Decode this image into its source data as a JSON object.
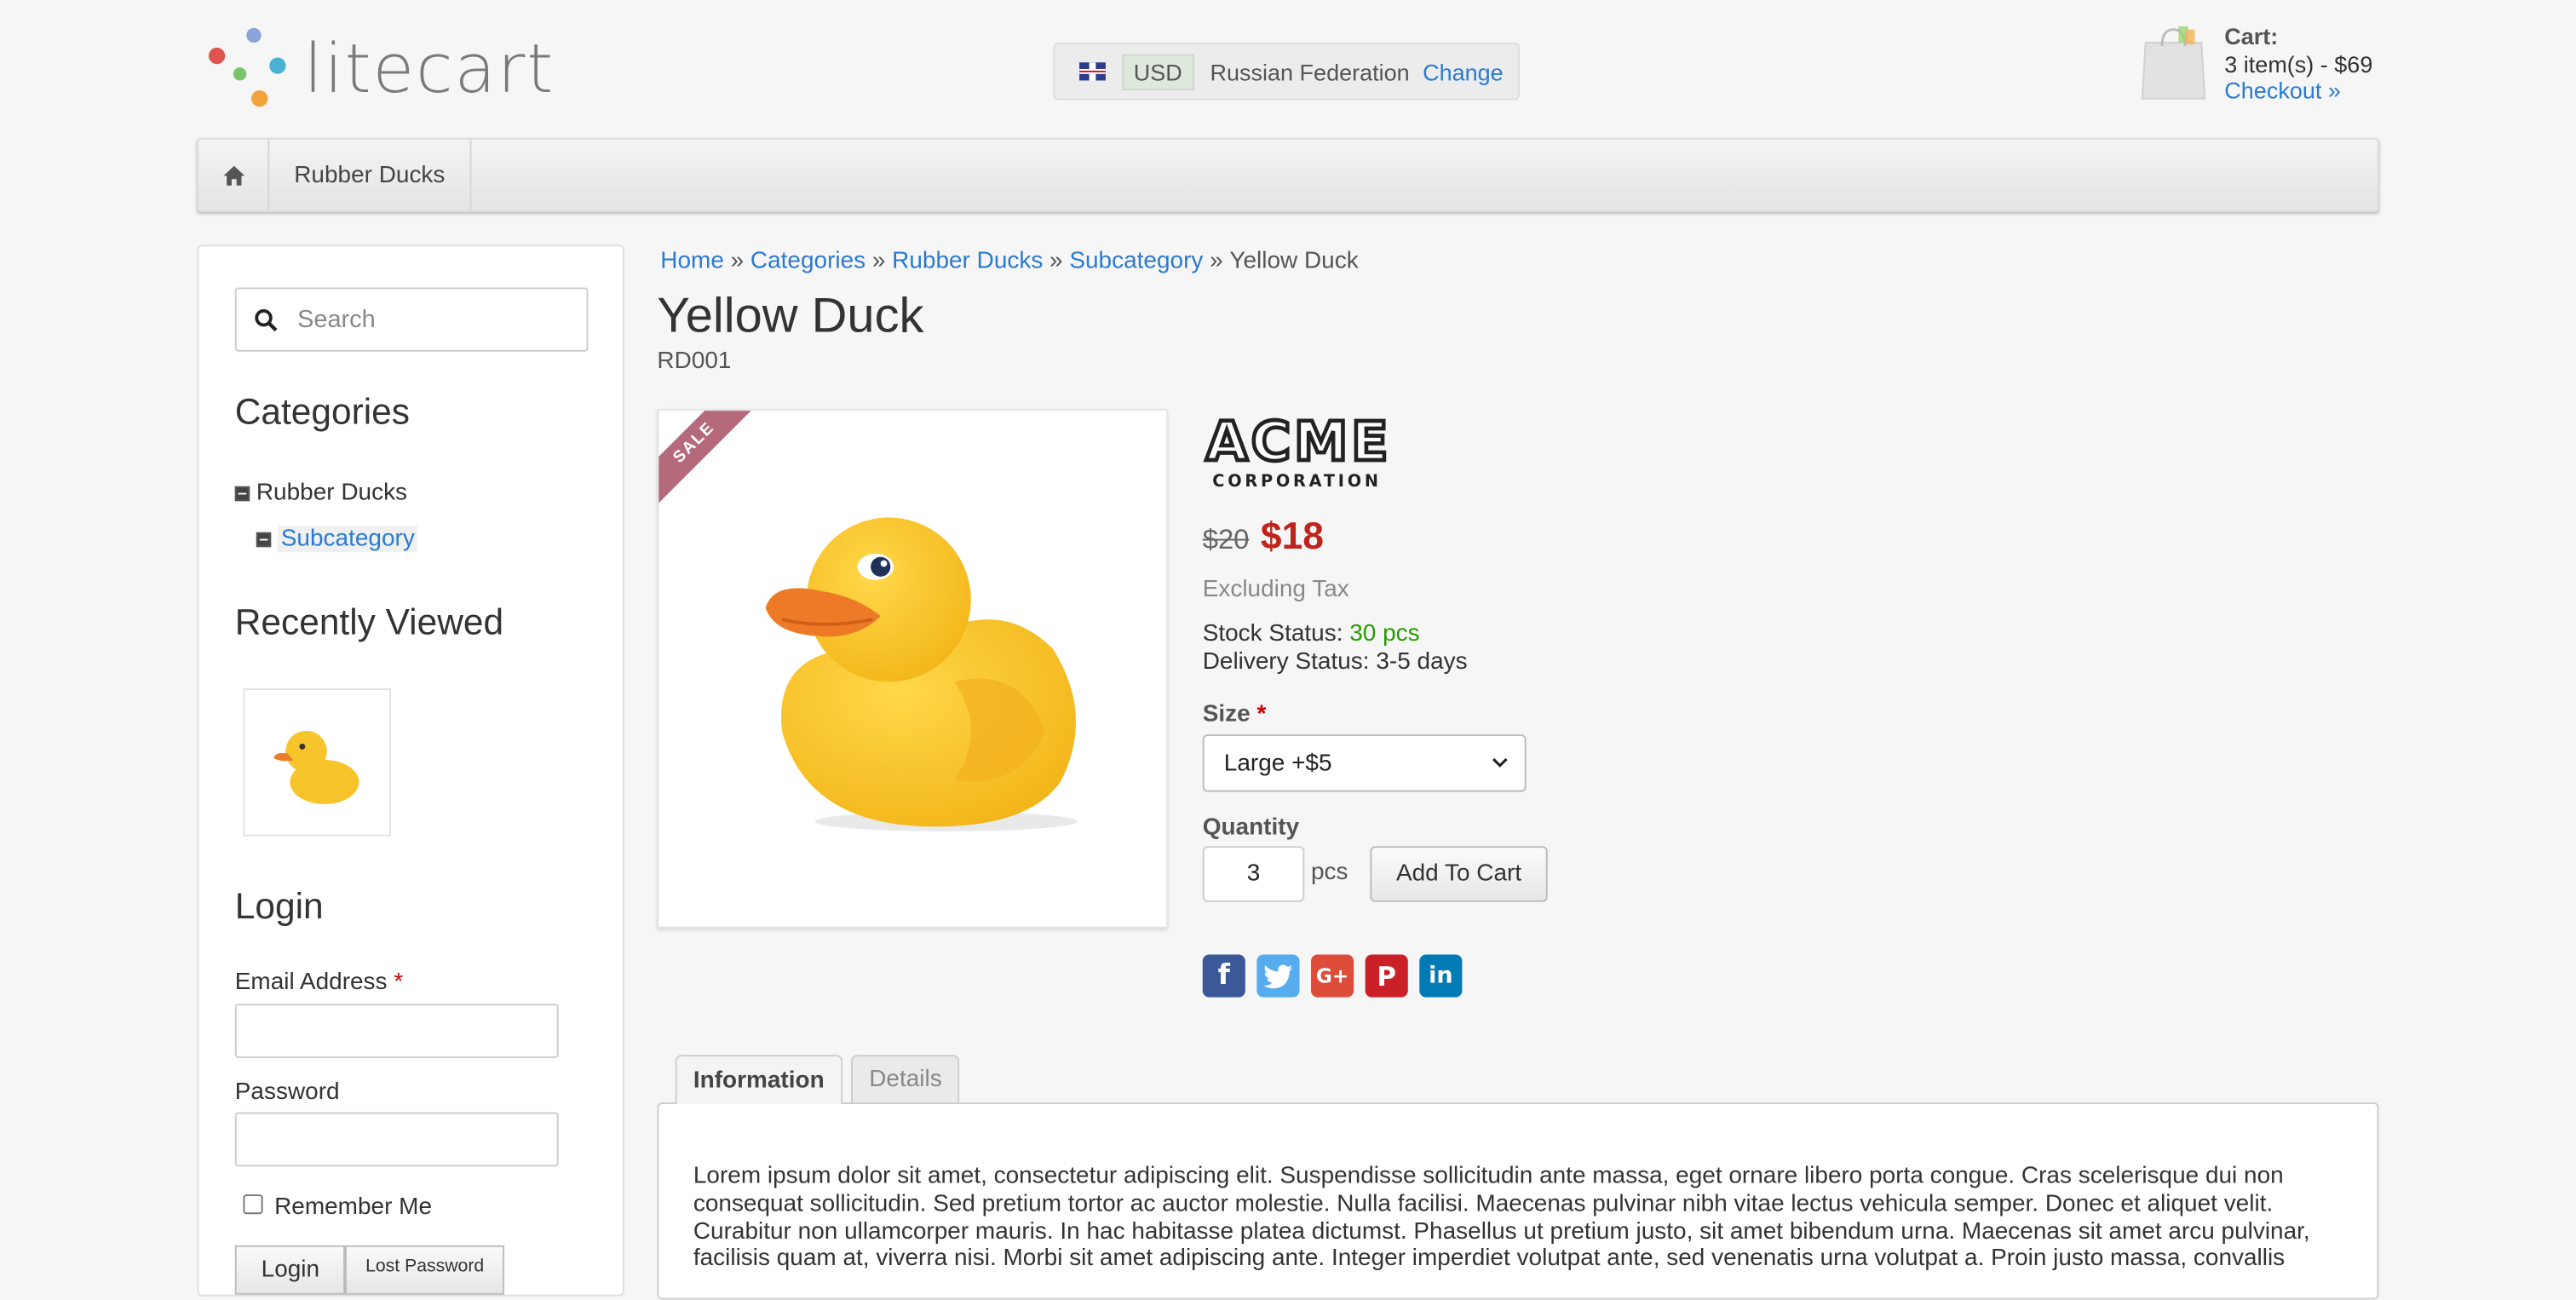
{
  "header": {
    "logo_text": "litecart",
    "currency": "USD",
    "country": "Russian Federation",
    "change_label": "Change",
    "cart_title": "Cart:",
    "cart_summary": "3 item(s) - $69",
    "checkout_label": "Checkout »"
  },
  "nav": {
    "items": [
      "Rubber Ducks"
    ]
  },
  "sidebar": {
    "search_placeholder": "Search",
    "categories_heading": "Categories",
    "categories": [
      {
        "label": "Rubber Ducks"
      },
      {
        "label": "Subcategory"
      }
    ],
    "recently_viewed_heading": "Recently Viewed",
    "login_heading": "Login",
    "email_label": "Email Address",
    "password_label": "Password",
    "remember_label": "Remember Me",
    "login_button": "Login",
    "lost_password_button": "Lost Password"
  },
  "breadcrumb": [
    "Home",
    "Categories",
    "Rubber Ducks",
    "Subcategory",
    "Yellow Duck"
  ],
  "product": {
    "name": "Yellow Duck",
    "sku": "RD001",
    "sale_badge": "SALE",
    "manufacturer_logo_text": "ACME CORPORATION",
    "regular_price": "$20",
    "campaign_price": "$18",
    "tax_note": "Excluding Tax",
    "stock_label": "Stock Status:",
    "stock_value": "30 pcs",
    "delivery_label": "Delivery Status:",
    "delivery_value": "3-5 days",
    "size_label": "Size",
    "size_selected": "Large +$5",
    "quantity_label": "Quantity",
    "quantity_value": "3",
    "quantity_unit": "pcs",
    "add_to_cart_label": "Add To Cart"
  },
  "social": [
    {
      "name": "facebook",
      "color": "#3b5998",
      "glyph": "f"
    },
    {
      "name": "twitter",
      "color": "#55acee",
      "glyph": "t"
    },
    {
      "name": "google-plus",
      "color": "#dd4b39",
      "glyph": "G+"
    },
    {
      "name": "pinterest",
      "color": "#cb2027",
      "glyph": "P"
    },
    {
      "name": "linkedin",
      "color": "#007bb6",
      "glyph": "in"
    }
  ],
  "tabs": {
    "information": "Information",
    "details": "Details"
  },
  "description": "Lorem ipsum dolor sit amet, consectetur adipiscing elit. Suspendisse sollicitudin ante massa, eget ornare libero porta congue. Cras scelerisque dui non consequat sollicitudin. Sed pretium tortor ac auctor molestie. Nulla facilisi. Maecenas pulvinar nibh vitae lectus vehicula semper. Donec et aliquet velit. Curabitur non ullamcorper mauris. In hac habitasse platea dictumst. Phasellus ut pretium justo, sit amet bibendum urna. Maecenas sit amet arcu pulvinar, facilisis quam at, viverra nisi. Morbi sit amet adipiscing ante. Integer imperdiet volutpat ante, sed venenatis urna volutpat a. Proin justo massa, convallis"
}
